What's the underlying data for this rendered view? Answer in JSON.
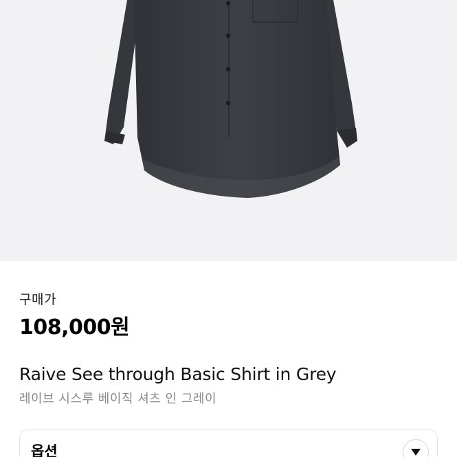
{
  "product": {
    "image_alt": "Raive See through Basic Shirt in Grey",
    "price_label": "구매가",
    "price": "108,000원",
    "title_en": "Raive See through Basic Shirt in Grey",
    "title_ko": "레이브 시스루 베이직 셔츠 인 그레이"
  },
  "options": {
    "title": "옵션",
    "toggle_icon": "chevron-down-icon"
  },
  "colors": {
    "hero_background": "#f2f2f4",
    "shirt": "#3a3d42",
    "muted_text": "#8a8a8e"
  }
}
